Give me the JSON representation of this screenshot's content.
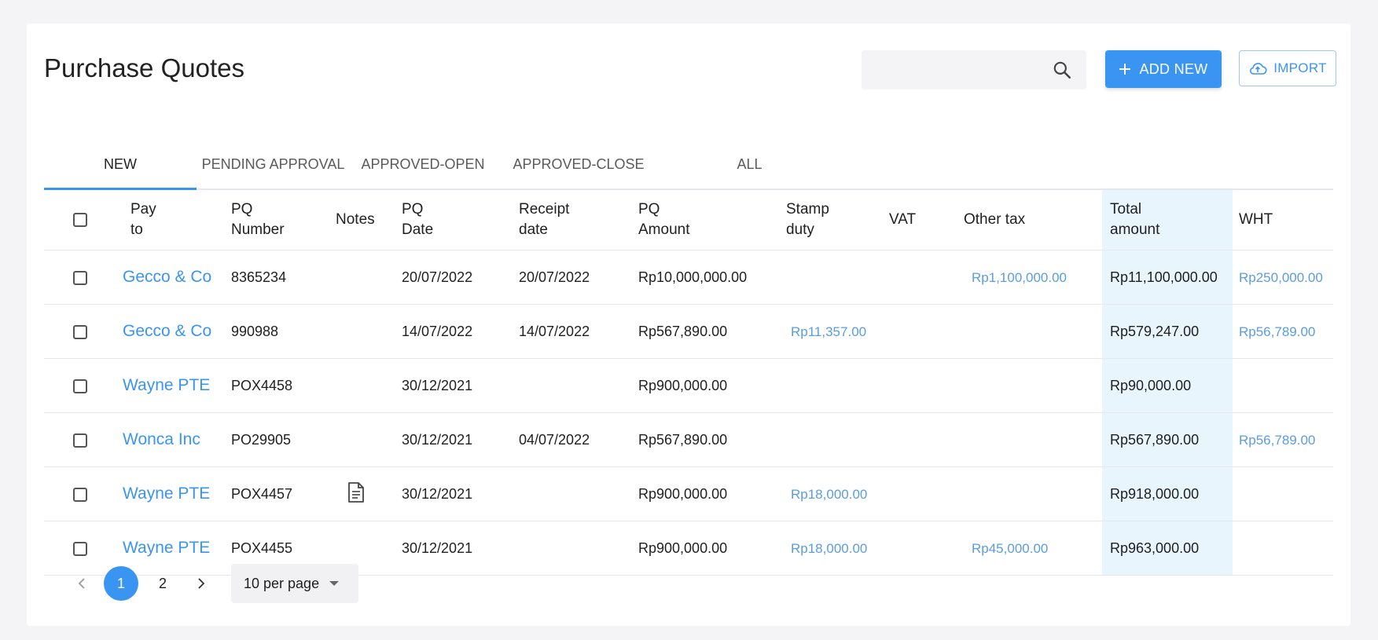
{
  "header": {
    "title": "Purchase Quotes",
    "search": {
      "value": "",
      "placeholder": ""
    },
    "add_new_label": "ADD NEW",
    "import_label": "IMPORT"
  },
  "tabs": [
    {
      "label": "NEW",
      "active": true
    },
    {
      "label": "PENDING APPROVAL",
      "active": false
    },
    {
      "label": "APPROVED-OPEN",
      "active": false
    },
    {
      "label": "APPROVED-CLOSE",
      "active": false
    },
    {
      "label": "ALL",
      "active": false
    }
  ],
  "table": {
    "columns": {
      "pay_to": [
        "Pay",
        "to"
      ],
      "pq_number": [
        "PQ",
        "Number"
      ],
      "notes": [
        "Notes"
      ],
      "pq_date": [
        "PQ",
        "Date"
      ],
      "receipt_date": [
        "Receipt",
        "date"
      ],
      "pq_amount": [
        "PQ",
        "Amount"
      ],
      "stamp_duty": [
        "Stamp",
        "duty"
      ],
      "vat": [
        "VAT"
      ],
      "other_tax": [
        "Other tax"
      ],
      "total_amount": [
        "Total",
        "amount"
      ],
      "wht": [
        "WHT"
      ]
    },
    "rows": [
      {
        "pay_to": "Gecco & Co",
        "pq_number": "8365234",
        "has_note": false,
        "pq_date": "20/07/2022",
        "receipt_date": "20/07/2022",
        "pq_amount": "Rp10,000,000.00",
        "stamp_duty": "",
        "vat": "",
        "other_tax": "Rp1,100,000.00",
        "total_amount": "Rp11,100,000.00",
        "wht": "Rp250,000.00"
      },
      {
        "pay_to": "Gecco & Co",
        "pq_number": "990988",
        "has_note": false,
        "pq_date": "14/07/2022",
        "receipt_date": "14/07/2022",
        "pq_amount": "Rp567,890.00",
        "stamp_duty": "Rp11,357.00",
        "vat": "",
        "other_tax": "",
        "total_amount": "Rp579,247.00",
        "wht": "Rp56,789.00"
      },
      {
        "pay_to": "Wayne PTE",
        "pq_number": "POX4458",
        "has_note": false,
        "pq_date": "30/12/2021",
        "receipt_date": "",
        "pq_amount": "Rp900,000.00",
        "stamp_duty": "",
        "vat": "",
        "other_tax": "",
        "total_amount": "Rp90,000.00",
        "wht": ""
      },
      {
        "pay_to": "Wonca Inc",
        "pq_number": "PO29905",
        "has_note": false,
        "pq_date": "30/12/2021",
        "receipt_date": "04/07/2022",
        "pq_amount": "Rp567,890.00",
        "stamp_duty": "",
        "vat": "",
        "other_tax": "",
        "total_amount": "Rp567,890.00",
        "wht": "Rp56,789.00"
      },
      {
        "pay_to": "Wayne PTE",
        "pq_number": "POX4457",
        "has_note": true,
        "pq_date": "30/12/2021",
        "receipt_date": "",
        "pq_amount": "Rp900,000.00",
        "stamp_duty": "Rp18,000.00",
        "vat": "",
        "other_tax": "",
        "total_amount": "Rp918,000.00",
        "wht": ""
      },
      {
        "pay_to": "Wayne PTE",
        "pq_number": "POX4455",
        "has_note": false,
        "pq_date": "30/12/2021",
        "receipt_date": "",
        "pq_amount": "Rp900,000.00",
        "stamp_duty": "Rp18,000.00",
        "vat": "",
        "other_tax": "Rp45,000.00",
        "total_amount": "Rp963,000.00",
        "wht": ""
      }
    ]
  },
  "pagination": {
    "pages": [
      "1",
      "2"
    ],
    "current": "1",
    "per_page": "10 per page"
  },
  "colors": {
    "accent": "#3a95f2",
    "link_light": "#5a9de0",
    "total_column_bg": "#e8f5fd"
  },
  "icons": {
    "search": "search-icon",
    "add": "plus-icon",
    "import": "cloud-upload-icon",
    "note": "document-icon",
    "prev": "chevron-left-icon",
    "next": "chevron-right-icon",
    "dropdown": "caret-down-icon"
  }
}
